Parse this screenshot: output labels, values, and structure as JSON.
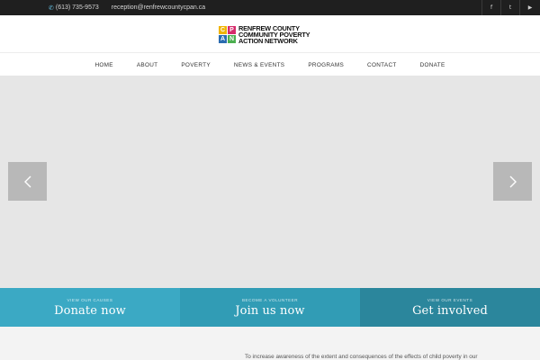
{
  "topbar": {
    "phone": "(613) 735-9573",
    "email": "reception@renfrewcountycpan.ca",
    "social": [
      {
        "name": "facebook",
        "glyph": "f"
      },
      {
        "name": "twitter",
        "glyph": "t"
      },
      {
        "name": "youtube",
        "glyph": "▶"
      }
    ]
  },
  "logo": {
    "mark_letters": [
      "C",
      "P",
      "A",
      "N"
    ],
    "mark_colors": [
      "#f0b400",
      "#d62a6b",
      "#2b6cb0",
      "#4caf50"
    ],
    "lines": [
      "RENFREW COUNTY",
      "COMMUNITY POVERTY",
      "ACTION NETWORK"
    ]
  },
  "nav": {
    "items": [
      "HOME",
      "ABOUT",
      "POVERTY",
      "NEWS & EVENTS",
      "PROGRAMS",
      "CONTACT",
      "DONATE"
    ]
  },
  "slider": {
    "prev_icon": "chevron-left-icon",
    "next_icon": "chevron-right-icon"
  },
  "cta": {
    "panels": [
      {
        "kicker": "VIEW OUR CAUSES",
        "headline": "Donate now",
        "color": "#3ba9c4"
      },
      {
        "kicker": "BECOME A VOLUNTEER",
        "headline": "Join us now",
        "color": "#319cb5"
      },
      {
        "kicker": "VIEW OUR EVENTS",
        "headline": "Get involved",
        "color": "#2b869c"
      }
    ]
  },
  "content": {
    "intro": "To increase awareness of the extent and consequences of the effects of child poverty in our"
  }
}
